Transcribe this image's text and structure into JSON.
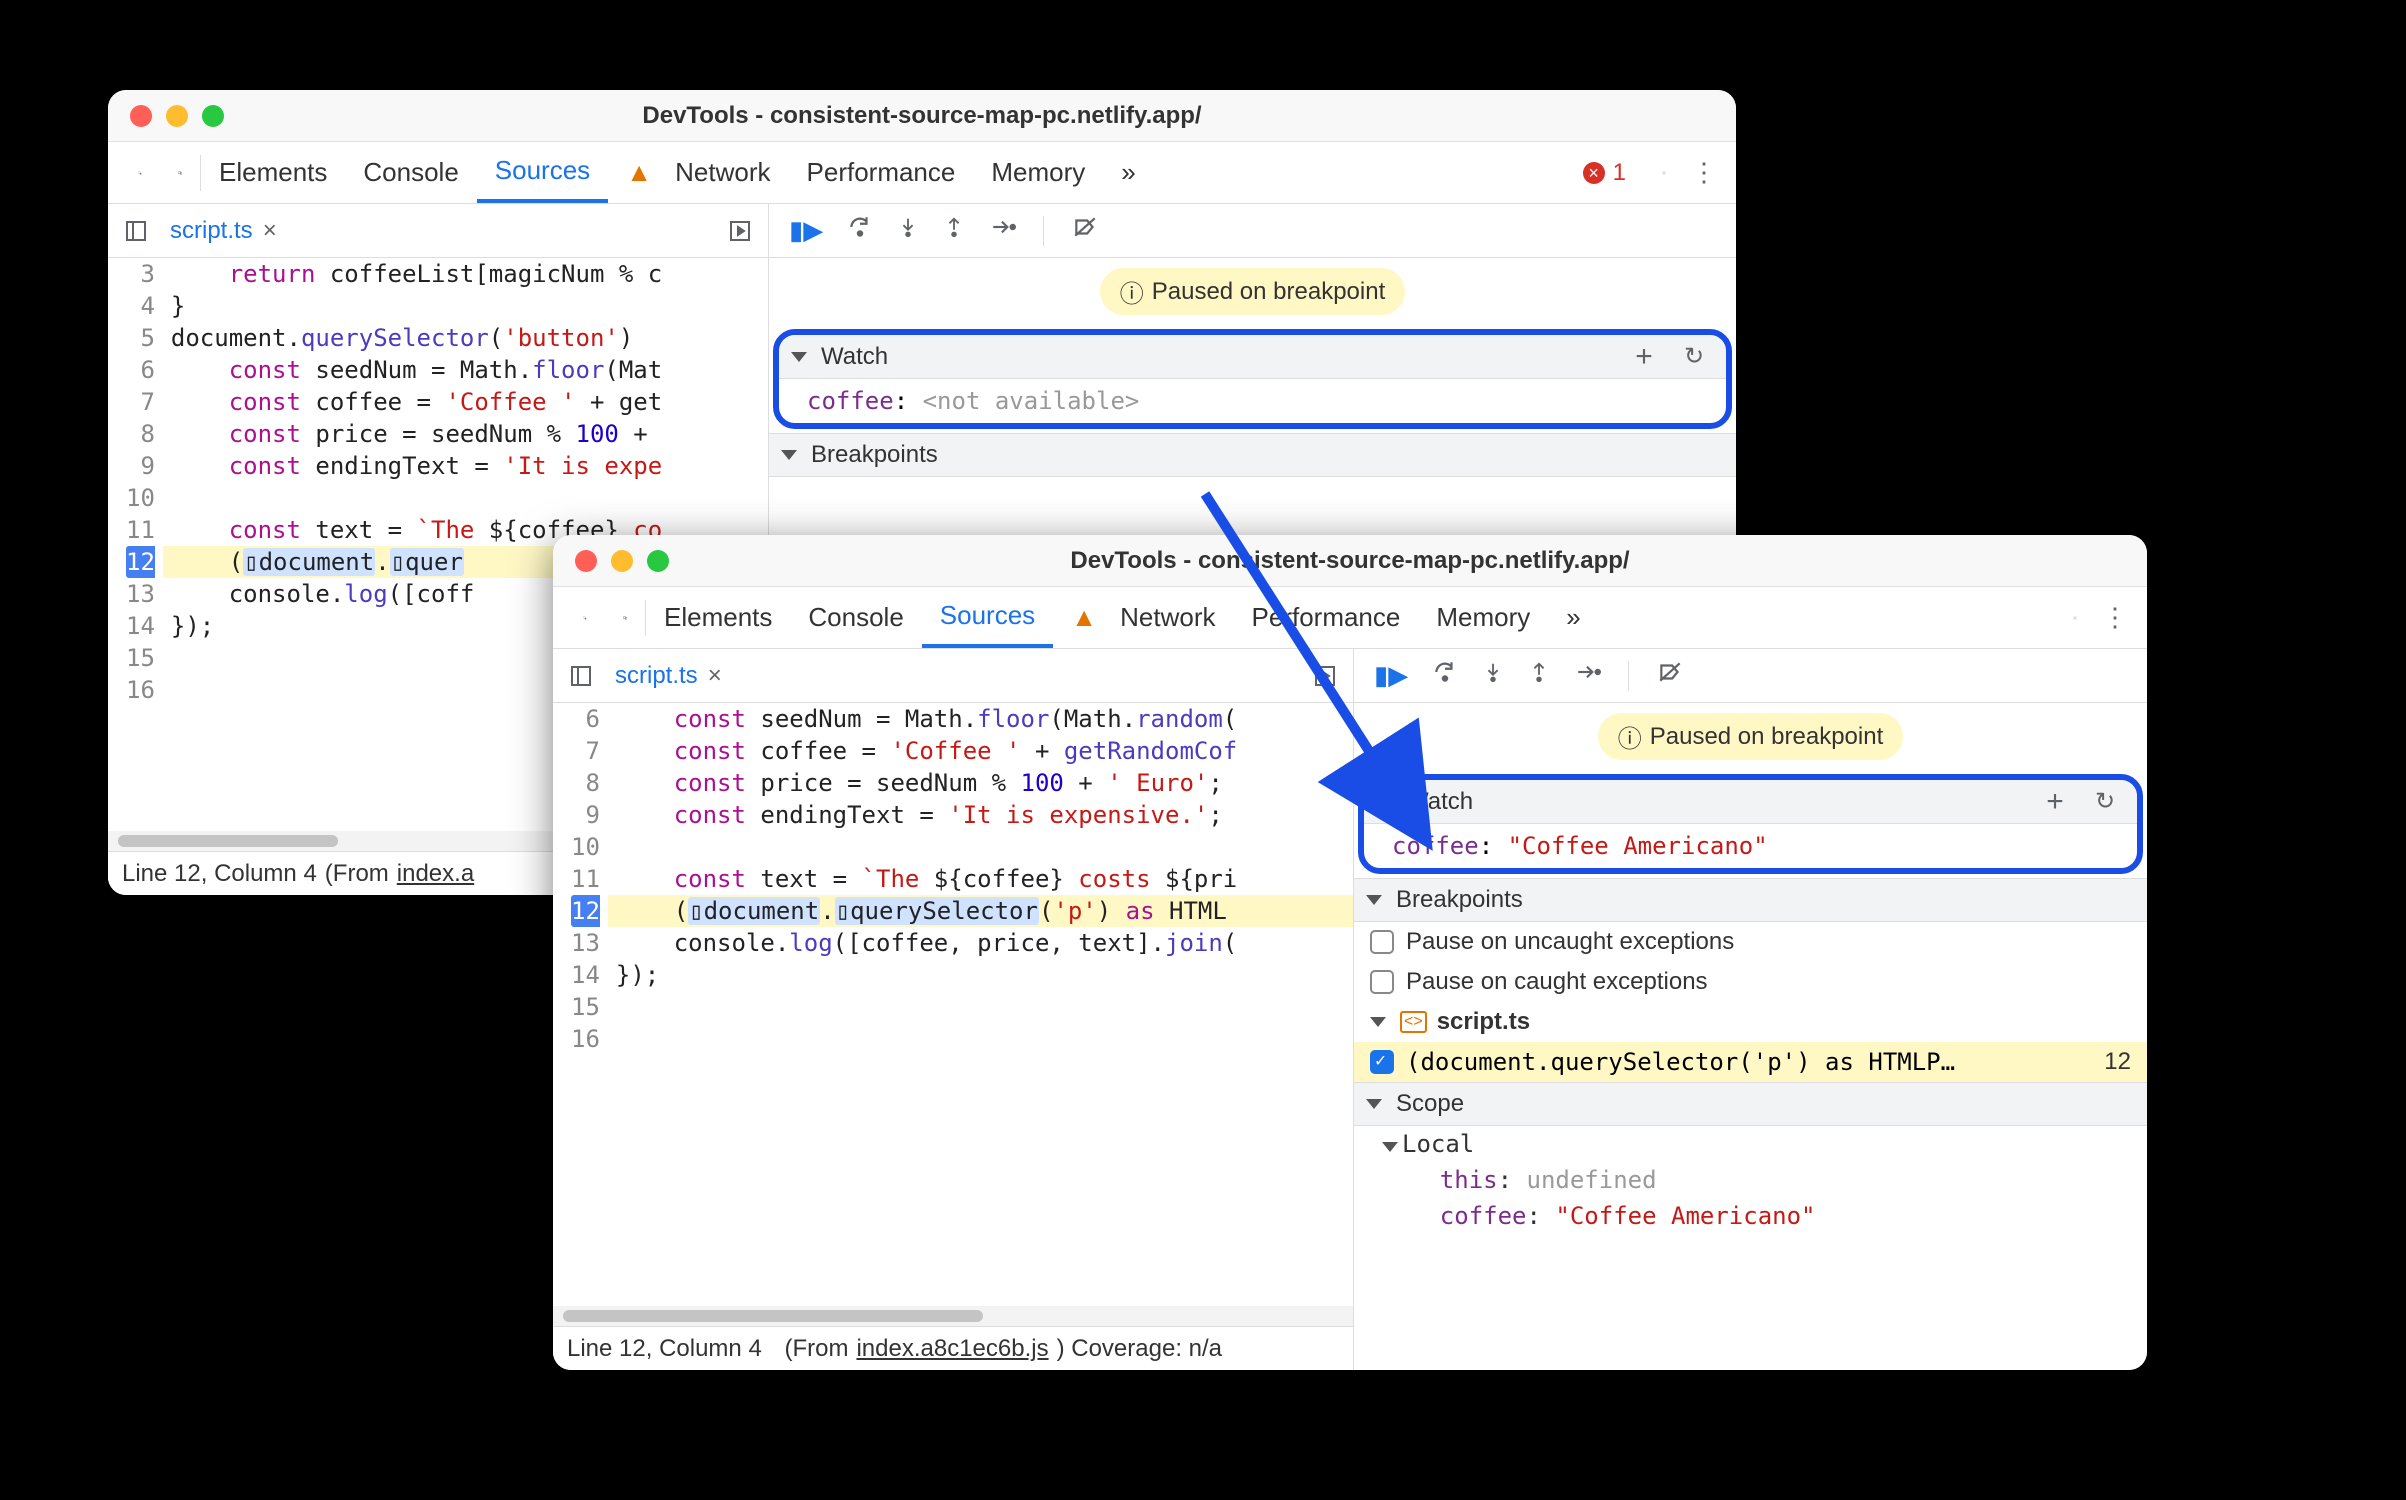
{
  "windowA": {
    "title": "DevTools - consistent-source-map-pc.netlify.app/",
    "tabs": [
      "Elements",
      "Console",
      "Sources",
      "Network",
      "Performance",
      "Memory"
    ],
    "activeTab": "Sources",
    "errorCount": "1",
    "filename": "script.ts",
    "code": {
      "startLine": 3,
      "currentLine": 12,
      "lines": [
        {
          "n": 3,
          "html": "    <span class='tk-k'>return</span> coffeeList[magicNum % c"
        },
        {
          "n": 4,
          "html": "}"
        },
        {
          "n": 5,
          "html": "document.<span class='tk-fn'>querySelector</span>(<span class='tk-s'>'button'</span>)"
        },
        {
          "n": 6,
          "html": "    <span class='tk-k'>const</span> seedNum = Math.<span class='tk-fn'>floor</span>(Mat"
        },
        {
          "n": 7,
          "html": "    <span class='tk-k'>const</span> coffee = <span class='tk-s'>'Coffee '</span> + get"
        },
        {
          "n": 8,
          "html": "    <span class='tk-k'>const</span> price = seedNum % <span class='tk-num'>100</span> + "
        },
        {
          "n": 9,
          "html": "    <span class='tk-k'>const</span> endingText = <span class='tk-s'>'It is expe"
        },
        {
          "n": 10,
          "html": ""
        },
        {
          "n": 11,
          "html": "    <span class='tk-k'>const</span> text = <span class='tk-s'>`The </span>${coffee}<span class='tk-s'> co"
        },
        {
          "n": 12,
          "html": "    (<span class='tk-pill'>▯document</span>.<span class='tk-pill'>▯quer</span>",
          "hi": true
        },
        {
          "n": 13,
          "html": "    console.<span class='tk-fn'>log</span>([coff"
        },
        {
          "n": 14,
          "html": "});"
        },
        {
          "n": 15,
          "html": ""
        },
        {
          "n": 16,
          "html": ""
        }
      ]
    },
    "pausedMsg": "Paused on breakpoint",
    "watch": {
      "title": "Watch",
      "name": "coffee",
      "value": "<not available>",
      "isString": false
    },
    "breakpoints": {
      "title": "Breakpoints"
    },
    "status": {
      "line": "Line 12, Column 4",
      "from": "(From ",
      "file": "index.a"
    }
  },
  "windowB": {
    "title": "DevTools - consistent-source-map-pc.netlify.app/",
    "tabs": [
      "Elements",
      "Console",
      "Sources",
      "Network",
      "Performance",
      "Memory"
    ],
    "activeTab": "Sources",
    "filename": "script.ts",
    "code": {
      "startLine": 6,
      "currentLine": 12,
      "lines": [
        {
          "n": 6,
          "html": "    <span class='tk-k'>const</span> seedNum = Math.<span class='tk-fn'>floor</span>(Math.<span class='tk-fn'>random</span>("
        },
        {
          "n": 7,
          "html": "    <span class='tk-k'>const</span> coffee = <span class='tk-s'>'Coffee '</span> + <span class='tk-fn'>getRandomCof</span>"
        },
        {
          "n": 8,
          "html": "    <span class='tk-k'>const</span> price = seedNum % <span class='tk-num'>100</span> + <span class='tk-s'>' Euro'</span>;"
        },
        {
          "n": 9,
          "html": "    <span class='tk-k'>const</span> endingText = <span class='tk-s'>'It is expensive.'</span>;"
        },
        {
          "n": 10,
          "html": ""
        },
        {
          "n": 11,
          "html": "    <span class='tk-k'>const</span> text = <span class='tk-s'>`The </span>${coffee}<span class='tk-s'> costs </span>${pri"
        },
        {
          "n": 12,
          "html": "    (<span class='tk-pill'>▯document</span>.<span class='tk-pill'>▯querySelector</span>(<span class='tk-s'>'p'</span>) <span class='tk-k'>as</span> HTML",
          "hi": true
        },
        {
          "n": 13,
          "html": "    console.<span class='tk-fn'>log</span>([coffee, price, text].<span class='tk-fn'>join</span>("
        },
        {
          "n": 14,
          "html": "});"
        },
        {
          "n": 15,
          "html": ""
        },
        {
          "n": 16,
          "html": ""
        }
      ]
    },
    "pausedMsg": "Paused on breakpoint",
    "watch": {
      "title": "Watch",
      "name": "coffee",
      "value": "\"Coffee Americano\"",
      "isString": true
    },
    "breakpoints": {
      "title": "Breakpoints",
      "opts": [
        "Pause on uncaught exceptions",
        "Pause on caught exceptions"
      ],
      "file": "script.ts",
      "entry": "(document.querySelector('p') as HTMLP…",
      "entryLine": "12"
    },
    "scope": {
      "title": "Scope",
      "local": "Local",
      "rows": [
        {
          "k": "this",
          "v": "undefined",
          "cls": "und"
        },
        {
          "k": "coffee",
          "v": "\"Coffee Americano\"",
          "cls": "str"
        }
      ]
    },
    "status": {
      "line": "Line 12, Column 4",
      "from": "(From ",
      "file": "index.a8c1ec6b.js",
      "cov": ") Coverage: n/a"
    }
  }
}
